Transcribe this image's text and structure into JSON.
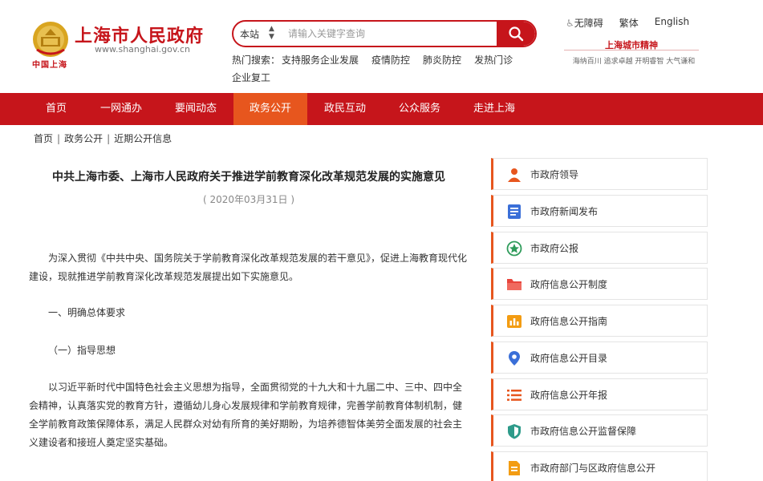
{
  "header": {
    "logo_title": "上海市人民政府",
    "logo_url": "www.shanghai.gov.cn",
    "logo_sub": "中国上海",
    "search": {
      "scope": "本站",
      "placeholder": "请输入关键字查询"
    },
    "hot_label": "热门搜索：",
    "hot_items": [
      "支持服务企业发展",
      "疫情防控",
      "肺炎防控",
      "发热门诊",
      "企业复工"
    ],
    "top_links": [
      "无障碍",
      "繁体",
      "English"
    ],
    "spirit_title": "上海城市精神",
    "spirit_sub": "海纳百川 追求卓越 开明睿智 大气谦和"
  },
  "nav": {
    "items": [
      "首页",
      "一网通办",
      "要闻动态",
      "政务公开",
      "政民互动",
      "公众服务",
      "走进上海"
    ],
    "active_index": 3
  },
  "breadcrumb": [
    "首页",
    "政务公开",
    "近期公开信息"
  ],
  "article": {
    "title": "中共上海市委、上海市人民政府关于推进学前教育深化改革规范发展的实施意见",
    "date": "( 2020年03月31日 )",
    "paragraphs": [
      "为深入贯彻《中共中央、国务院关于学前教育深化改革规范发展的若干意见》，促进上海教育现代化建设，现就推进学前教育深化改革规范发展提出如下实施意见。",
      "一、明确总体要求",
      "（一）指导思想",
      "以习近平新时代中国特色社会主义思想为指导，全面贯彻党的十九大和十九届二中、三中、四中全会精神，认真落实党的教育方针，遵循幼儿身心发展规律和学前教育规律，完善学前教育体制机制，健全学前教育政策保障体系，满足人民群众对幼有所育的美好期盼，为培养德智体美劳全面发展的社会主义建设者和接班人奠定坚实基础。"
    ]
  },
  "sidebar": {
    "items": [
      {
        "label": "市政府领导",
        "icon": "person-icon",
        "color": "#e7561e"
      },
      {
        "label": "市政府新闻发布",
        "icon": "document-icon",
        "color": "#3a6fd8"
      },
      {
        "label": "市政府公报",
        "icon": "star-badge-icon",
        "color": "#2e9b5a"
      },
      {
        "label": "政府信息公开制度",
        "icon": "folder-icon",
        "color": "#e8453c"
      },
      {
        "label": "政府信息公开指南",
        "icon": "bar-chart-icon",
        "color": "#f39c12"
      },
      {
        "label": "政府信息公开目录",
        "icon": "location-pin-icon",
        "color": "#3a6fd8"
      },
      {
        "label": "政府信息公开年报",
        "icon": "list-icon",
        "color": "#e7561e"
      },
      {
        "label": "市政府信息公开监督保障",
        "icon": "shield-icon",
        "color": "#2e9b8a"
      },
      {
        "label": "市政府部门与区政府信息公开",
        "icon": "file-icon",
        "color": "#f39c12"
      }
    ]
  },
  "colors": {
    "brand_red": "#c6151b",
    "nav_active": "#e7561e"
  }
}
